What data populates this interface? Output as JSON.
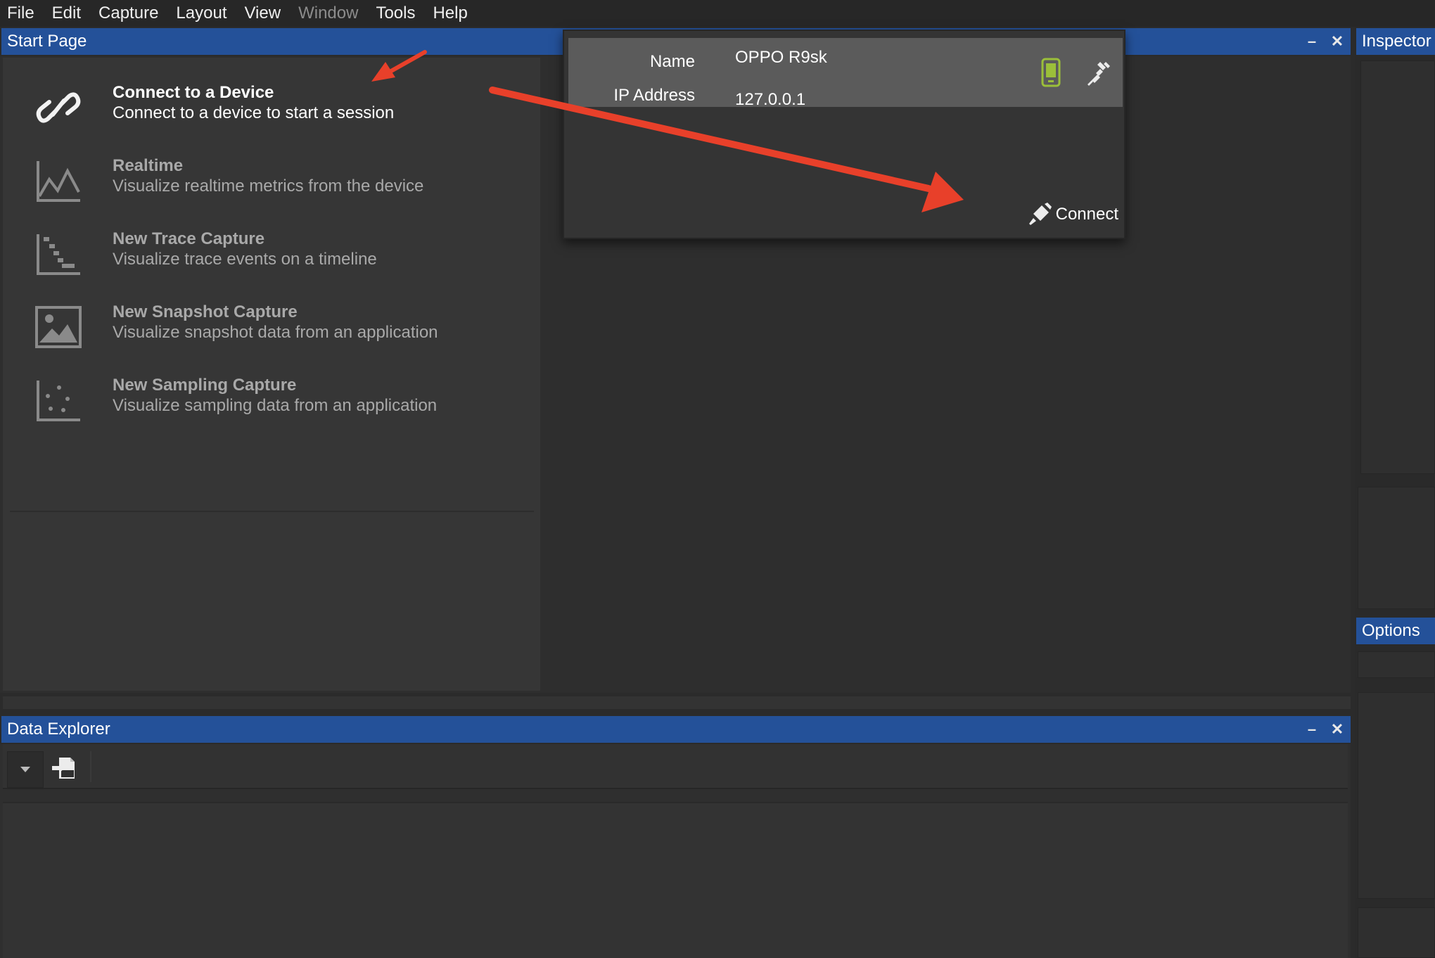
{
  "menu": {
    "items": [
      {
        "label": "File",
        "enabled": true
      },
      {
        "label": "Edit",
        "enabled": true
      },
      {
        "label": "Capture",
        "enabled": true
      },
      {
        "label": "Layout",
        "enabled": true
      },
      {
        "label": "View",
        "enabled": true
      },
      {
        "label": "Window",
        "enabled": false
      },
      {
        "label": "Tools",
        "enabled": true
      },
      {
        "label": "Help",
        "enabled": true
      }
    ]
  },
  "start_page": {
    "title": "Start Page",
    "minimize": "–",
    "close": "✕",
    "items": [
      {
        "title": "Connect to a Device",
        "description": "Connect to a device to start a session",
        "icon": "link-icon",
        "active": true
      },
      {
        "title": "Realtime",
        "description": "Visualize realtime metrics from the device",
        "icon": "realtime-chart-icon",
        "active": false
      },
      {
        "title": "New Trace Capture",
        "description": "Visualize trace events on a timeline",
        "icon": "trace-timeline-icon",
        "active": false
      },
      {
        "title": "New Snapshot Capture",
        "description": "Visualize snapshot data from an application",
        "icon": "snapshot-image-icon",
        "active": false
      },
      {
        "title": "New Sampling Capture",
        "description": "Visualize sampling data from an application",
        "icon": "sampling-scatter-icon",
        "active": false
      }
    ]
  },
  "device_popup": {
    "name_label": "Name",
    "name_value": "OPPO R9sk",
    "ip_label": "IP Address",
    "ip_value": "127.0.0.1",
    "connect_label": "Connect"
  },
  "inspector": {
    "title": "Inspector"
  },
  "options": {
    "title": "Options"
  },
  "data_explorer": {
    "title": "Data Explorer",
    "minimize": "–",
    "close": "✕"
  },
  "colors": {
    "header_blue": "#245199",
    "annotation_red": "#e8402a",
    "device_green": "#9bbf3a"
  }
}
